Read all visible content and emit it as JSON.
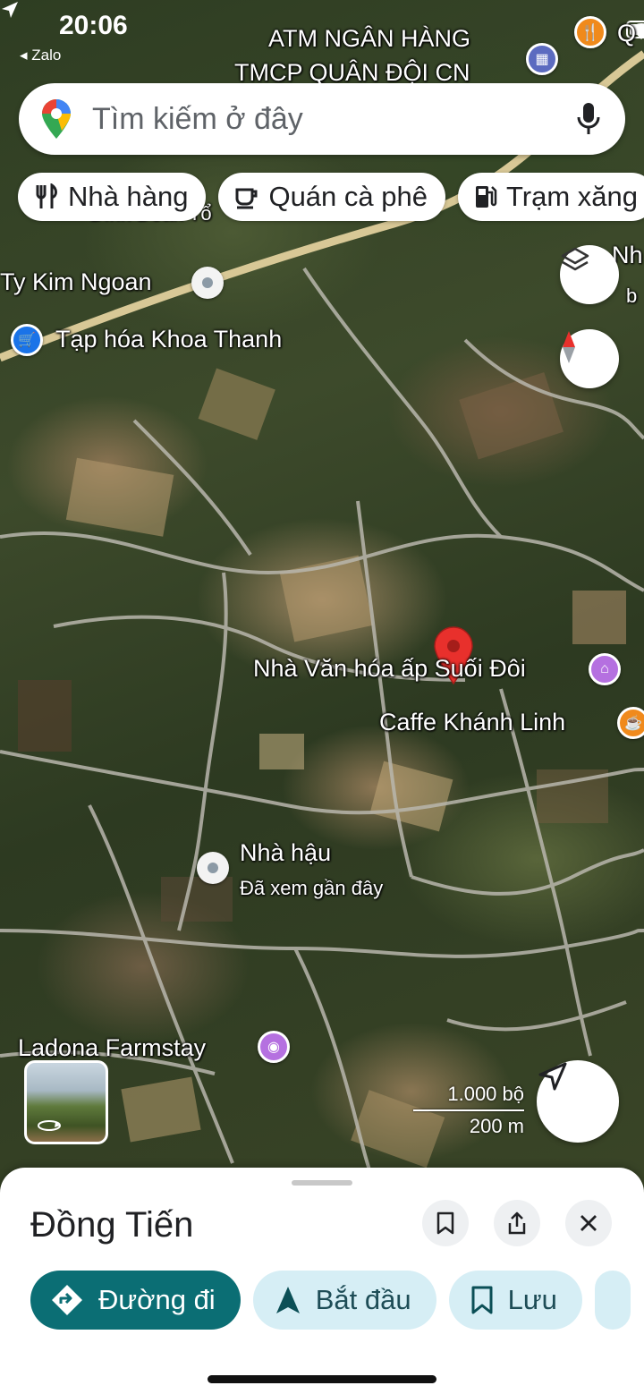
{
  "status_bar": {
    "time": "20:06",
    "back_app": "◂ Zalo"
  },
  "map": {
    "top_labels": [
      "ATM NGÂN HÀNG",
      "TMCP QUÂN ĐỘI CN"
    ],
    "partial_label_top_right": "Q",
    "label_dinh_doan": "Đình Đoàn Tổ",
    "label_kim_ngoan": "Ty Kim Ngoan",
    "label_tap_hoa": "Tạp hóa Khoa Thanh",
    "label_nha_right": "Nh",
    "label_b_right": "b",
    "label_nha_van_hoa": "Nhà Văn hóa ấp Suối Đôi",
    "label_caffe": "Caffe Khánh Linh",
    "label_nha_hau": "Nhà hậu",
    "label_nha_hau_sub": "Đã xem gần đây",
    "label_ladona": "Ladona Farmstay",
    "scale_imperial": "1.000 bộ",
    "scale_metric": "200 m"
  },
  "search": {
    "placeholder": "Tìm kiếm ở đây"
  },
  "chips": [
    {
      "label": "Nhà hàng",
      "icon": "fork-knife-icon"
    },
    {
      "label": "Quán cà phê",
      "icon": "coffee-cup-icon"
    },
    {
      "label": "Trạm xăng",
      "icon": "gas-station-icon"
    }
  ],
  "sheet": {
    "title": "Đồng Tiến",
    "actions": [
      {
        "label": "Đường đi",
        "icon": "directions-icon"
      },
      {
        "label": "Bắt đầu",
        "icon": "navigation-arrow-icon"
      },
      {
        "label": "Lưu",
        "icon": "bookmark-icon"
      }
    ]
  },
  "colors": {
    "primary": "#0b6e74",
    "secondary_bg": "#d6eef5",
    "marker_red": "#e8302c",
    "poi_purple": "#b570e0",
    "poi_blue": "#1a73e8",
    "poi_orange": "#f08a1c"
  }
}
